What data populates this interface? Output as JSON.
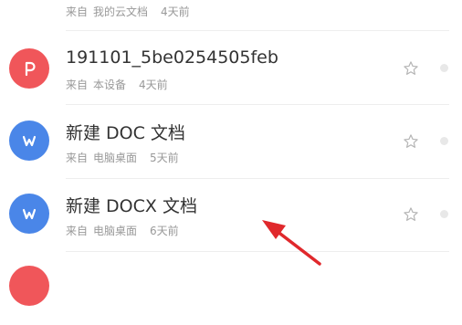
{
  "colors": {
    "green": "#4cbb7b",
    "red": "#f0565a",
    "blue": "#4a86e8",
    "arrow": "#e0282c"
  },
  "files": [
    {
      "title": "",
      "source_prefix": "来自",
      "source": "我的云文档",
      "time": "4天前",
      "icon": "document-icon"
    },
    {
      "title": "191101_5be0254505feb",
      "source_prefix": "来自",
      "source": "本设备",
      "time": "4天前",
      "icon": "presentation-icon"
    },
    {
      "title": "新建 DOC 文档",
      "source_prefix": "来自",
      "source": "电脑桌面",
      "time": "5天前",
      "icon": "word-icon"
    },
    {
      "title": "新建 DOCX 文档",
      "source_prefix": "来自",
      "source": "电脑桌面",
      "time": "6天前",
      "icon": "word-icon"
    }
  ]
}
